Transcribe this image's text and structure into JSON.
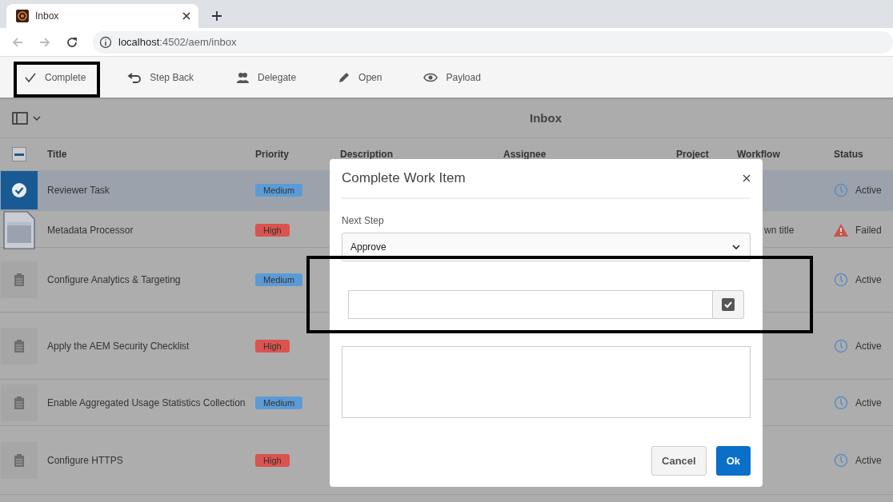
{
  "browser": {
    "tab_title": "Inbox",
    "url_host": "localhost",
    "url_rest": ":4502/aem/inbox"
  },
  "toolbar": [
    {
      "label": "Complete",
      "kind": "check"
    },
    {
      "label": "Step Back",
      "kind": "back"
    },
    {
      "label": "Delegate",
      "kind": "people"
    },
    {
      "label": "Open",
      "kind": "pencil"
    },
    {
      "label": "Payload",
      "kind": "eye"
    }
  ],
  "header": {
    "title": "Inbox"
  },
  "table": {
    "select_all_partial": true,
    "columns": [
      "Title",
      "Priority",
      "Description",
      "Assignee",
      "Project",
      "Workflow",
      "Status"
    ],
    "rows": [
      {
        "title": "Reviewer Task",
        "priority": "Medium",
        "color": "#5b9bd5",
        "selected": true,
        "status": {
          "kind": "active",
          "label": "Active"
        }
      },
      {
        "kind": "document",
        "title": "Metadata Processor",
        "priority": "High",
        "color": "#d9534f",
        "selected": false,
        "workflow": "wn title",
        "status": {
          "kind": "failed",
          "label": "Failed"
        }
      },
      {
        "kind": "task",
        "title": "Configure Analytics & Targeting",
        "priority": "Medium",
        "color": "#5b9bd5",
        "selected": false,
        "status": {
          "kind": "active",
          "label": "Active"
        }
      },
      {
        "kind": "task",
        "title": "Apply the AEM Security Checklist",
        "priority": "High",
        "color": "#d9534f",
        "selected": false,
        "status": {
          "kind": "active",
          "label": "Active"
        }
      },
      {
        "kind": "task",
        "title": "Enable Aggregated Usage Statistics Collection",
        "priority": "Medium",
        "color": "#5b9bd5",
        "selected": false,
        "status": {
          "kind": "active",
          "label": "Active"
        }
      },
      {
        "kind": "task",
        "title": "Configure HTTPS",
        "priority": "High",
        "color": "#d9534f",
        "selected": false,
        "status": {
          "kind": "active",
          "label": "Active"
        }
      }
    ]
  },
  "dialog": {
    "title": "Complete Work Item",
    "next_step_label": "Next Step",
    "next_step_value": "Approve",
    "checked": true,
    "buttons": [
      {
        "label": "Cancel",
        "kind": "secondary"
      },
      {
        "label": "Ok",
        "kind": "primary"
      }
    ]
  }
}
